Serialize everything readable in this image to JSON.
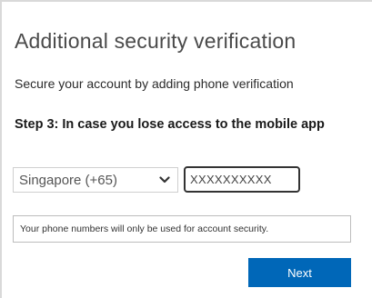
{
  "header": {
    "title": "Additional security verification",
    "subtitle": "Secure your account by adding phone verification"
  },
  "step": {
    "text": "Step 3: In case you lose access to the mobile app"
  },
  "phone_form": {
    "country_value": "Singapore (+65)",
    "phone_value": "XXXXXXXXXX",
    "dropdown_icon": "chevron-down-icon"
  },
  "notice": {
    "text": "Your phone numbers will only be used for account security."
  },
  "actions": {
    "next_label": "Next"
  },
  "colors": {
    "accent": "#0067b8",
    "title": "#4a4a4a",
    "border": "#cfcfcf"
  }
}
